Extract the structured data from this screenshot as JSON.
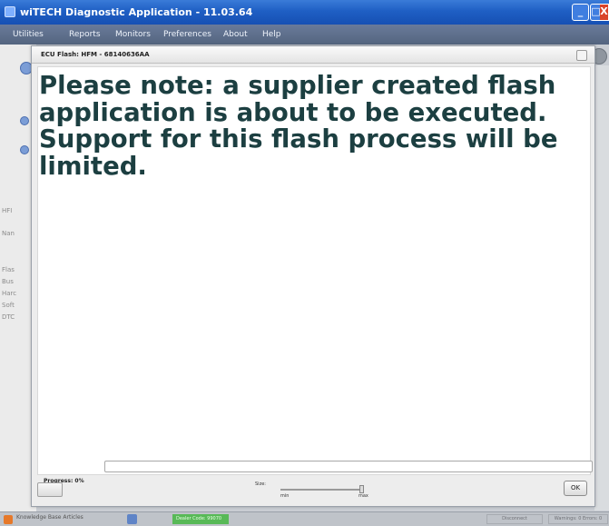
{
  "window": {
    "title": "wiTECH Diagnostic Application - 11.03.64",
    "icon": "app-icon",
    "minimize_label": "_",
    "maximize_label": "□",
    "close_label": "X"
  },
  "menu": [
    "Utilities",
    "Reports",
    "Monitors",
    "Preferences",
    "About",
    "Help"
  ],
  "background": {
    "left_labels": [
      "HFI",
      "Nan",
      "Flas",
      "Bus",
      "Harc",
      "Soft",
      "DTC"
    ]
  },
  "dialog": {
    "title": "ECU Flash: HFM - 68140636AA",
    "message": "Please note: a supplier created flash application is about to be executed. Support for this flash process will be limited.",
    "progress_label": "Progress: 0%",
    "progress_value": 0,
    "size_label": "Size:",
    "slider_min": "min",
    "slider_max": "max",
    "ok_label": "OK"
  },
  "statusbar": {
    "knowledge_base": "Knowledge Base Articles",
    "dealer_code": "Dealer Code: 99070",
    "disconnect": "Disconnect",
    "warnings": "Warnings: 0 Errors: 0"
  },
  "colors": {
    "titlebar": "#1f5fc4",
    "message_text": "#1c3f41",
    "dealer_badge": "#58b957"
  }
}
